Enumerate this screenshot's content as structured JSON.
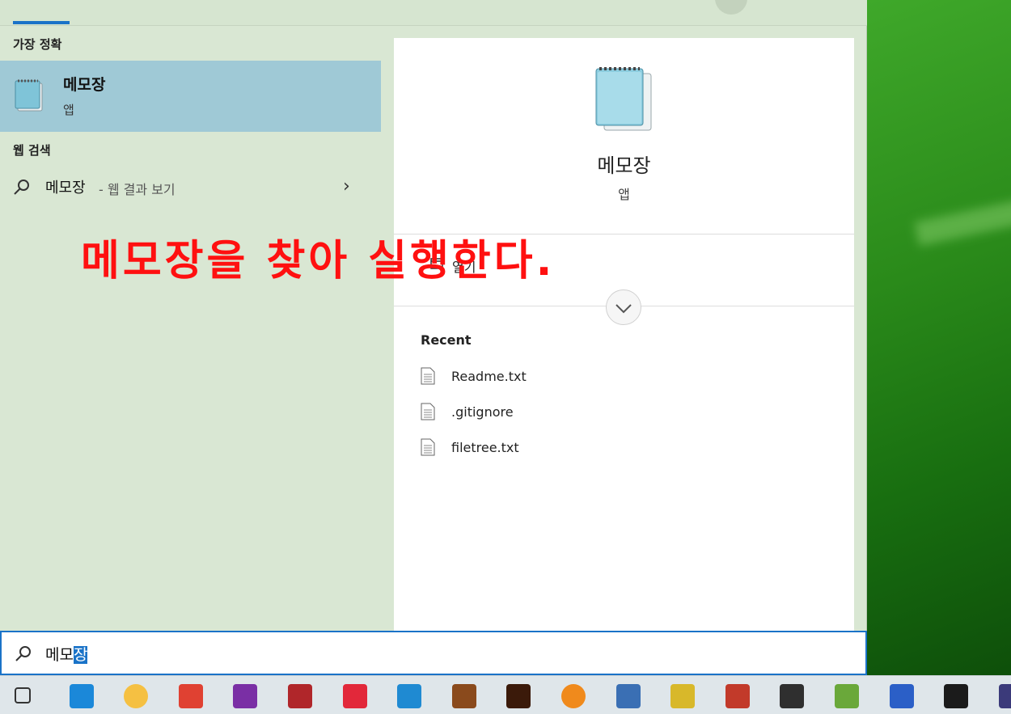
{
  "left_pane": {
    "best_match_label": "가장 정확",
    "best_match": {
      "title": "메모장",
      "subtitle": "앱"
    },
    "web_search_label": "웹 검색",
    "web_result": {
      "query": "메모장",
      "hint": "- 웹 결과 보기"
    }
  },
  "detail": {
    "app_name": "메모장",
    "app_kind": "앱",
    "open_label": "열기",
    "recent_title": "Recent",
    "recent_files": [
      "Readme.txt",
      ".gitignore",
      "filetree.txt"
    ]
  },
  "annotation": "메모장을 찾아 실행한다.",
  "search": {
    "typed_plain": "메모",
    "typed_selected": "장"
  },
  "taskbar_icons": [
    {
      "name": "task-view-icon",
      "color": "#333333"
    },
    {
      "name": "edge-icon",
      "color": "#1b88d9"
    },
    {
      "name": "file-explorer-icon",
      "color": "#f5c042"
    },
    {
      "name": "chrome-icon",
      "color": "#e04132"
    },
    {
      "name": "onenote-icon",
      "color": "#7a2fa5"
    },
    {
      "name": "app-red-square-icon",
      "color": "#b0262a"
    },
    {
      "name": "app-red-stripes-icon",
      "color": "#e2283a"
    },
    {
      "name": "vscode-icon",
      "color": "#1f8ad2"
    },
    {
      "name": "diablo-icon",
      "color": "#8a4a1c"
    },
    {
      "name": "diablo-dark-icon",
      "color": "#3b1a0a"
    },
    {
      "name": "magnifier-app-icon",
      "color": "#f08a1c"
    },
    {
      "name": "hancom-icon",
      "color": "#3a6fb4"
    },
    {
      "name": "audio-app-icon",
      "color": "#d8b82a"
    },
    {
      "name": "stripes-app-icon",
      "color": "#c23a2a"
    },
    {
      "name": "terminal-app-icon",
      "color": "#2f2f2f"
    },
    {
      "name": "notepadpp-icon",
      "color": "#6aa83a"
    },
    {
      "name": "wps-icon",
      "color": "#2b5fc7"
    },
    {
      "name": "pycharm-icon",
      "color": "#1b1b1b"
    },
    {
      "name": "eclipse-icon",
      "color": "#3b3a7a"
    }
  ]
}
